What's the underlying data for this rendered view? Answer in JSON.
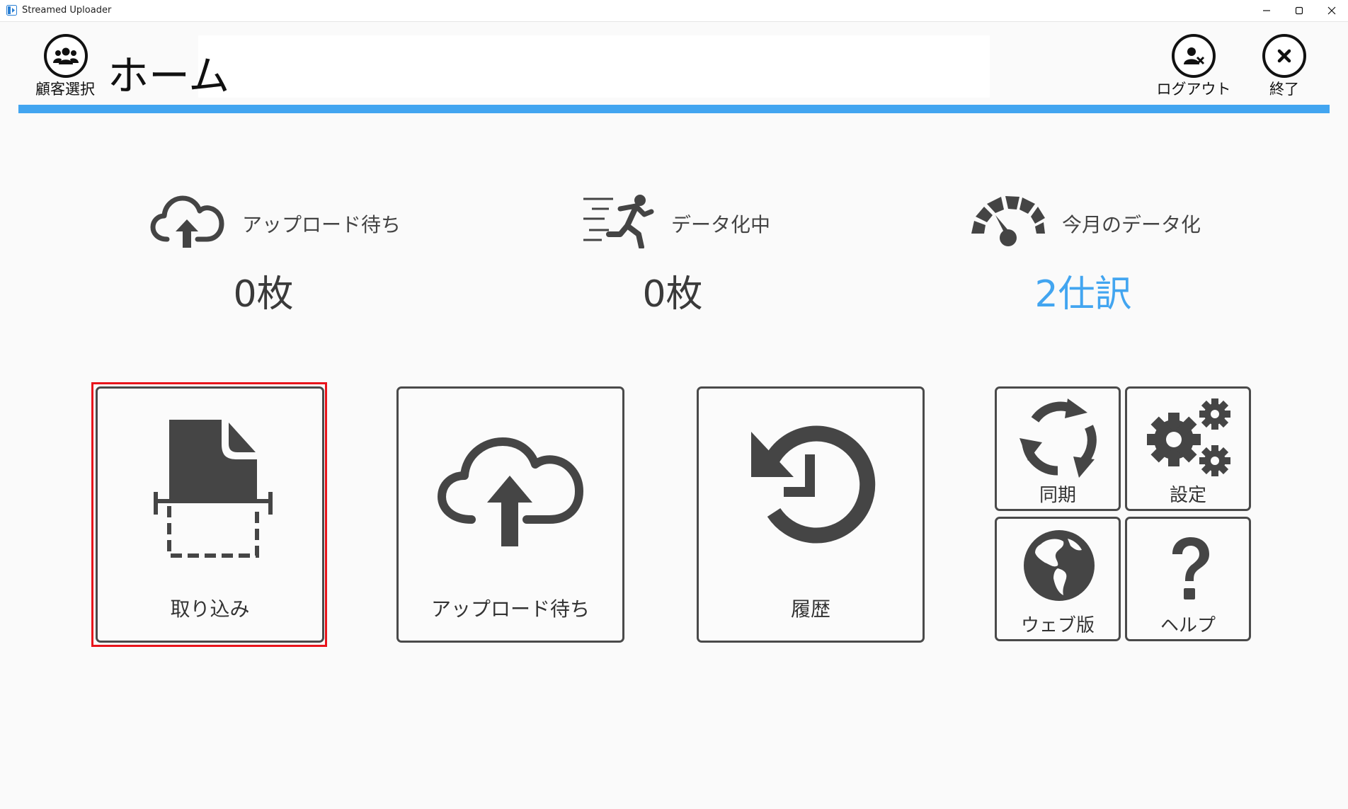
{
  "window": {
    "title": "Streamed Uploader"
  },
  "header": {
    "page_title": "ホーム",
    "customer_select_label": "顧客選択",
    "logout_label": "ログアウト",
    "exit_label": "終了"
  },
  "stats": [
    {
      "label": "アップロード待ち",
      "value": "0枚",
      "icon": "cloud-upload-icon"
    },
    {
      "label": "データ化中",
      "value": "0枚",
      "icon": "running-person-icon"
    },
    {
      "label": "今月のデータ化",
      "value": "2仕訳",
      "icon": "speedometer-icon"
    }
  ],
  "tiles": {
    "import": {
      "label": "取り込み",
      "icon": "scan-document-icon"
    },
    "upload_queue": {
      "label": "アップロード待ち",
      "icon": "cloud-upload-icon"
    },
    "history": {
      "label": "履歴",
      "icon": "history-icon"
    },
    "sync": {
      "label": "同期",
      "icon": "sync-icon"
    },
    "settings": {
      "label": "設定",
      "icon": "gears-icon"
    },
    "web": {
      "label": "ウェブ版",
      "icon": "globe-icon"
    },
    "help": {
      "label": "ヘルプ",
      "icon": "question-icon"
    }
  },
  "colors": {
    "accent": "#42a5f0",
    "selection": "#e8141b",
    "icon": "#454545"
  }
}
